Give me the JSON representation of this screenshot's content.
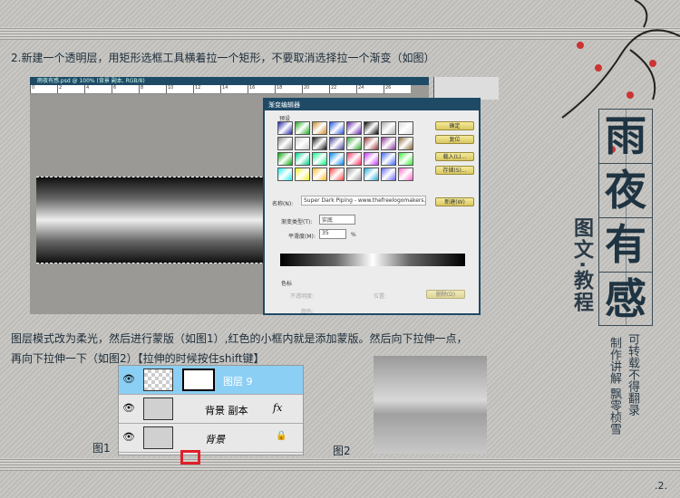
{
  "intro": "2.新建一个透明层，用矩形选框工具横着拉一个矩形，不要取消选择拉一个渐变（如图）",
  "ps": {
    "title": "雨夜有感.psd @ 100% (背景 副本, RGB/8)",
    "ruler": [
      "0",
      "2",
      "4",
      "6",
      "8",
      "10",
      "12",
      "14",
      "16",
      "18",
      "20",
      "22",
      "24",
      "26"
    ]
  },
  "dialog": {
    "title": "渐变编辑器",
    "presets": "预设",
    "ok": "确定",
    "reset": "复位",
    "load": "载入(L)...",
    "save": "存储(S)...",
    "name_label": "名称(N):",
    "name_value": "Super Dark Piping - www.thefreelogomakers.c",
    "new": "新建(W)",
    "type_label": "渐变类型(T):",
    "type_value": "实底",
    "smooth_label": "平滑度(M):",
    "smooth_value": "35",
    "pct": "%",
    "stops": "色标",
    "opacity": "不透明度:",
    "color": "颜色:",
    "location": "位置:",
    "delete": "删除(D)"
  },
  "body1": "图层模式改为柔光，然后进行蒙版（如图1）,红色的小框内就是添加蒙版。然后向下拉伸一点，",
  "body2": "再向下拉伸一下（如图2）【拉伸的时候按住shift键】",
  "layers": [
    {
      "name": "图层 9",
      "selected": true
    },
    {
      "name": "背景 副本",
      "fx": "fx"
    },
    {
      "name": "背景",
      "locked": true
    }
  ],
  "fig1": "图1",
  "fig2": "图2",
  "brand": {
    "logo": [
      "雨",
      "夜",
      "有",
      "感"
    ],
    "subtitle": "图文·教程",
    "col1": "可转载不得翻录",
    "col2": "制作讲解 飘零桢雪"
  },
  "page": ".2.",
  "colors": {
    "text": "#1d2d3a",
    "titlebar": "#1f4a66",
    "selected_layer": "#8ccff5",
    "mask_highlight": "#e0202a"
  }
}
